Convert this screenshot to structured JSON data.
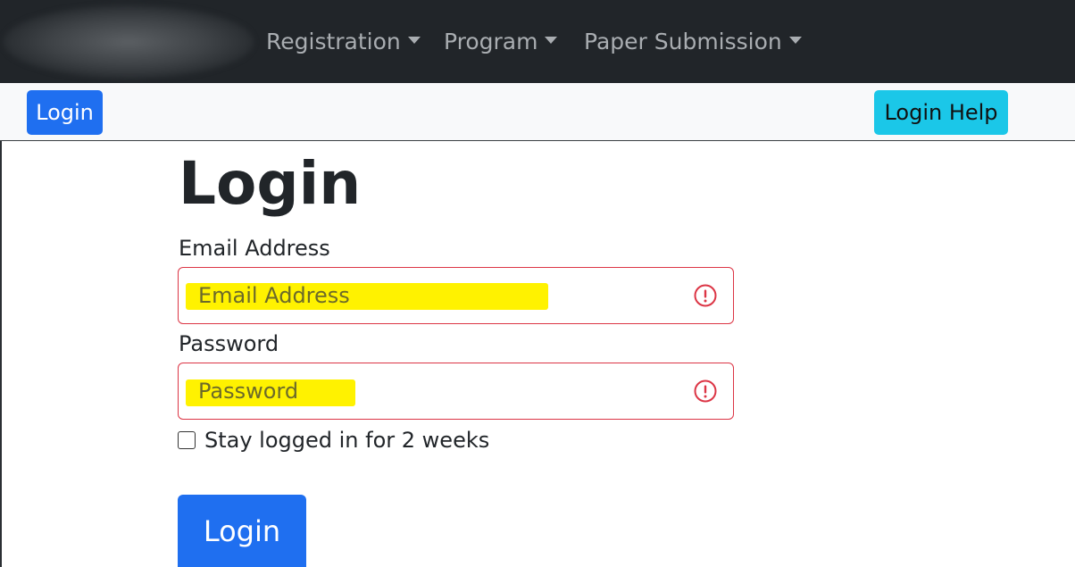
{
  "navbar": {
    "items": [
      {
        "label": "Registration"
      },
      {
        "label": "Program"
      },
      {
        "label": "Paper Submission"
      }
    ]
  },
  "subbar": {
    "login_label": "Login",
    "help_label": "Login Help"
  },
  "form": {
    "title": "Login",
    "email": {
      "label": "Email Address",
      "placeholder": "Email Address",
      "value": ""
    },
    "password": {
      "label": "Password",
      "placeholder": "Password",
      "value": ""
    },
    "remember": {
      "label": "Stay logged in for 2 weeks",
      "checked": false
    },
    "submit_label": "Login"
  },
  "colors": {
    "navbar_bg": "#212529",
    "primary": "#1f6ff0",
    "info": "#1bc7e8",
    "error": "#dc3545",
    "highlight": "#fff200"
  }
}
